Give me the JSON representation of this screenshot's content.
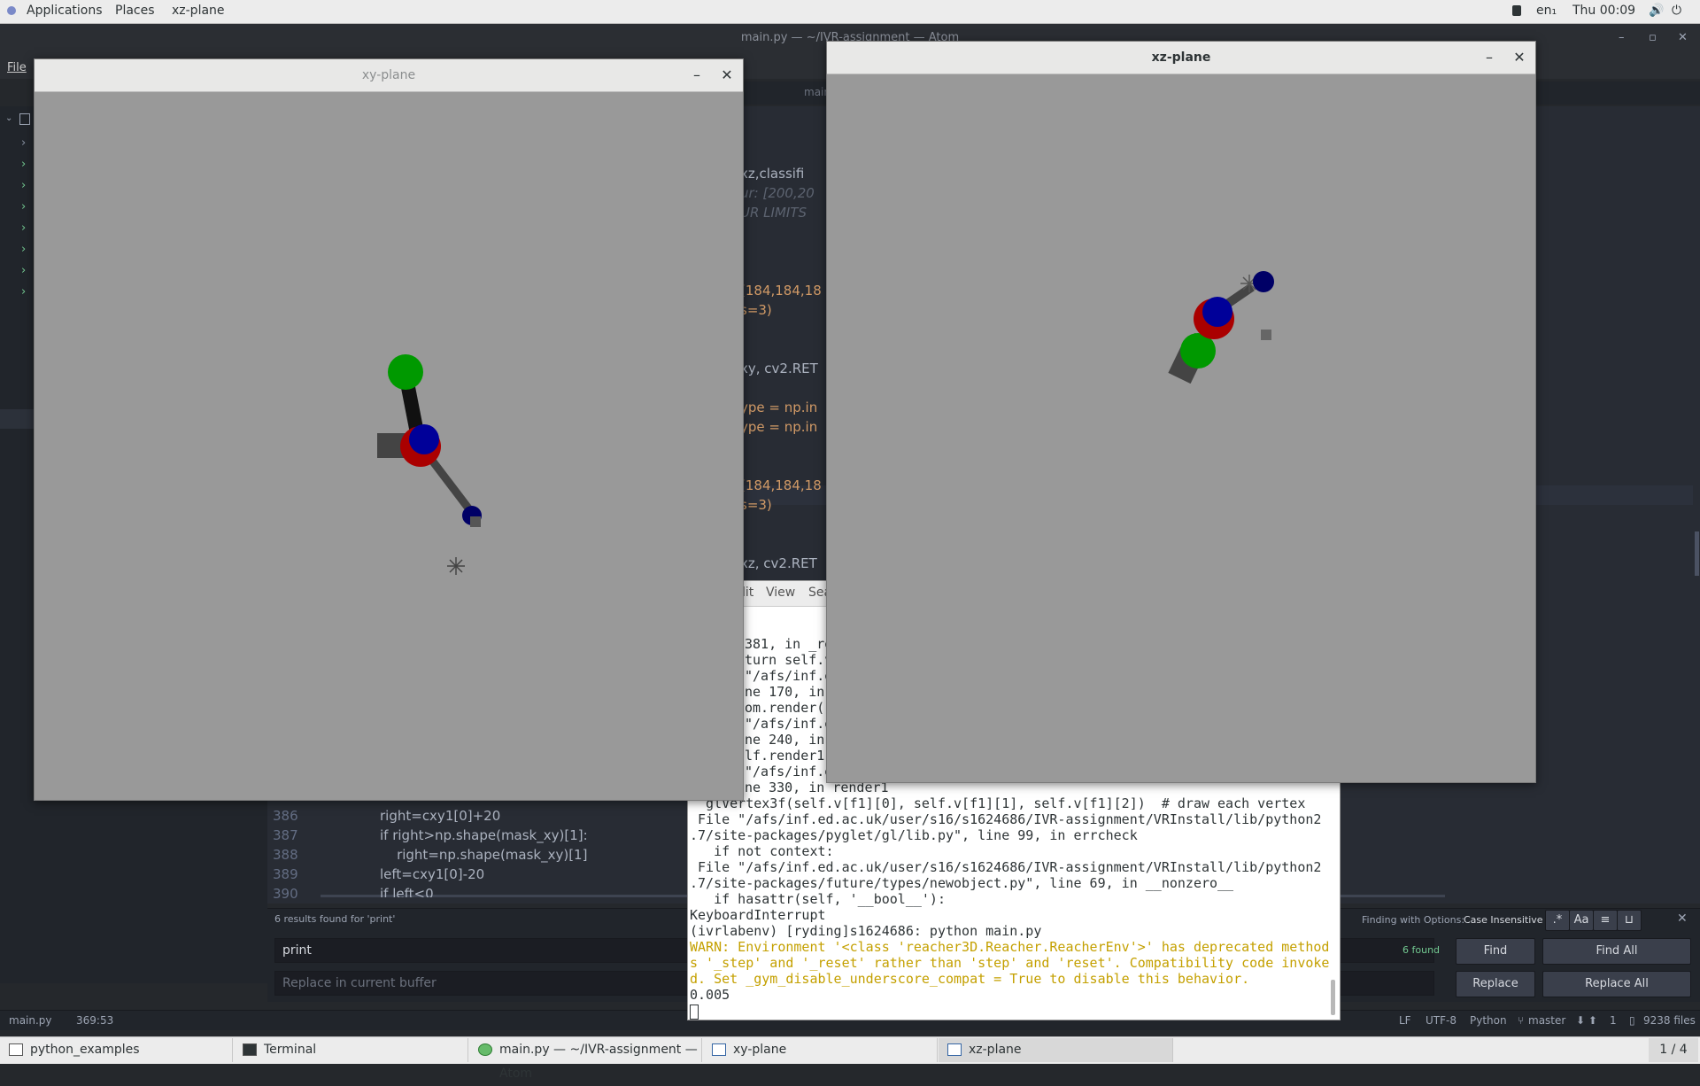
{
  "topbar": {
    "applications": "Applications",
    "places": "Places",
    "active_app": "xz-plane",
    "lang": "en₁",
    "clock": "Thu 00:09"
  },
  "atom": {
    "title": "main.py — ~/IVR-assignment — Atom",
    "menu_file": "File",
    "tab_label": "main",
    "code_fragments": [
      "xz,classifi",
      "ur: [200,20",
      "UR LIMITS",
      "(184,184,18",
      "s=3)",
      "xy, cv2.RET",
      "ype = np.in",
      "ype = np.in",
      "(184,184,18",
      "s=3)",
      "xz, cv2.RET"
    ],
    "line_numbers": [
      "386",
      "387",
      "388",
      "389",
      "390"
    ],
    "bottom_code": [
      "right=cxy1[0]+20",
      "if right>np.shape(mask_xy)[1]:",
      "    right=np.shape(mask_xy)[1]",
      "left=cxy1[0]-20",
      "if left<0"
    ],
    "find": {
      "results_text": "6 results found for 'print'",
      "find_value": "print",
      "replace_placeholder": "Replace in current buffer",
      "found_count": "6 found",
      "options_text": "Finding with Options:",
      "options_value": "Case Insensitive",
      "find_btn": "Find",
      "find_all_btn": "Find All",
      "replace_btn": "Replace",
      "replace_all_btn": "Replace All",
      "regex_toggle": ".*",
      "case_toggle": "Aa"
    },
    "status": {
      "file": "main.py",
      "cursor": "369:53",
      "eol": "LF",
      "encoding": "UTF-8",
      "grammar": "Python",
      "branch": "master",
      "git_counts": "1",
      "files": "9238 files"
    }
  },
  "terminal": {
    "menu": [
      "dit",
      "View",
      "Sea"
    ],
    "lines": [
      "381, in _re",
      "turn self.v",
      "\"/afs/inf.e",
      "ne 170, in",
      "om.render()",
      "\"/afs/inf.e",
      "ne 240, in",
      "lf.render1(",
      "\"/afs/inf.e",
      "ne 330, in render1",
      "  glVertex3f(self.v[f1][0], self.v[f1][1], self.v[f1][2])  # draw each vertex",
      " File \"/afs/inf.ed.ac.uk/user/s16/s1624686/IVR-assignment/VRInstall/lib/python2",
      ".7/site-packages/pyglet/gl/lib.py\", line 99, in errcheck",
      "   if not context:",
      " File \"/afs/inf.ed.ac.uk/user/s16/s1624686/IVR-assignment/VRInstall/lib/python2",
      ".7/site-packages/future/types/newobject.py\", line 69, in __nonzero__",
      "   if hasattr(self, '__bool__'):",
      "KeyboardInterrupt",
      "(ivrlabenv) [ryding]s1624686: python main.py"
    ],
    "warn_lines": [
      "WARN: Environment '<class 'reacher3D.Reacher.ReacherEnv'>' has deprecated method",
      "s '_step' and '_reset' rather than 'step' and 'reset'. Compatibility code invoke",
      "d. Set _gym_disable_underscore_compat = True to disable this behavior."
    ],
    "last_line": "0.005"
  },
  "windows": {
    "xy_title": "xy-plane",
    "xz_title": "xz-plane"
  },
  "taskbar": {
    "items": [
      "python_examples",
      "Terminal",
      "main.py — ~/IVR-assignment — Atom",
      "xy-plane",
      "xz-plane"
    ],
    "workspace": "1 / 4"
  },
  "colors": {
    "render_bg": "#999999",
    "joint_green": "#009900",
    "joint_red": "#aa0000",
    "joint_blue": "#000099",
    "link_dark": "#111111",
    "link_gray": "#444444"
  }
}
